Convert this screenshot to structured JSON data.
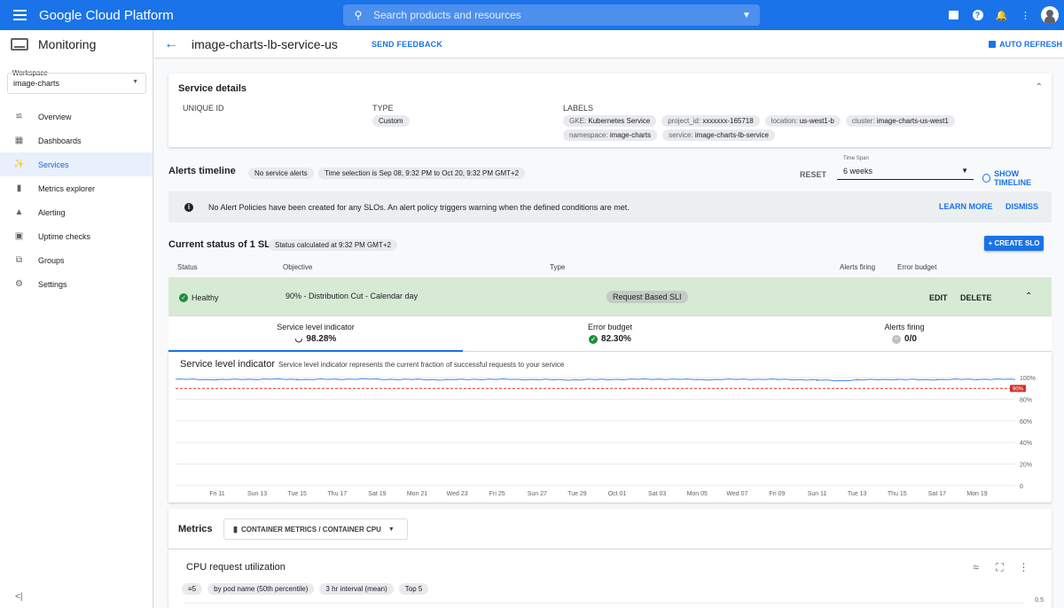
{
  "topbar": {
    "brand": "Google Cloud Platform",
    "search_placeholder": "Search products and resources",
    "icons": [
      "cloud-shell-icon",
      "help-icon",
      "notifications-icon",
      "more-vert-icon",
      "avatar"
    ]
  },
  "sidebar": {
    "title": "Monitoring",
    "workspace_label": "Workspace",
    "workspace_value": "image-charts",
    "items": [
      {
        "label": "Overview",
        "icon": "overview-icon",
        "active": false
      },
      {
        "label": "Dashboards",
        "icon": "dashboards-icon",
        "active": false
      },
      {
        "label": "Services",
        "icon": "services-icon",
        "active": true
      },
      {
        "label": "Metrics explorer",
        "icon": "metrics-explorer-icon",
        "active": false
      },
      {
        "label": "Alerting",
        "icon": "alerting-icon",
        "active": false
      },
      {
        "label": "Uptime checks",
        "icon": "uptime-checks-icon",
        "active": false
      },
      {
        "label": "Groups",
        "icon": "groups-icon",
        "active": false
      },
      {
        "label": "Settings",
        "icon": "settings-icon",
        "active": false
      }
    ]
  },
  "header": {
    "title": "image-charts-lb-service-us",
    "feedback": "SEND FEEDBACK",
    "auto_refresh": "AUTO REFRESH"
  },
  "service_details": {
    "title": "Service details",
    "unique_id_label": "UNIQUE ID",
    "type_label": "TYPE",
    "type_value": "Custom",
    "labels_label": "LABELS",
    "labels": [
      {
        "k": "GKE:",
        "v": "Kubernetes Service"
      },
      {
        "k": "project_id:",
        "v": "xxxxxxx-165718"
      },
      {
        "k": "location:",
        "v": "us-west1-b"
      },
      {
        "k": "cluster:",
        "v": "image-charts-us-west1"
      },
      {
        "k": "namespace:",
        "v": "image-charts"
      },
      {
        "k": "service:",
        "v": "image-charts-lb-service"
      }
    ]
  },
  "alerts_timeline": {
    "title": "Alerts timeline",
    "chip_no_alerts": "No service alerts",
    "chip_time": "Time selection is Sep 08, 9:32 PM to Oct 20, 9:32 PM GMT+2",
    "reset": "RESET",
    "time_span_label": "Time Span",
    "time_span_value": "6 weeks",
    "show_timeline": "SHOW TIMELINE"
  },
  "banner": {
    "text": "No Alert Policies have been created for any SLOs. An alert policy triggers warning when the defined conditions are met.",
    "learn_more": "LEARN MORE",
    "dismiss": "DISMISS"
  },
  "current_status": {
    "title": "Current status of 1 SLO",
    "chip": "Status calculated at 9:32 PM GMT+2",
    "create_button": "+ CREATE SLO",
    "columns": [
      "Status",
      "Objective",
      "Type",
      "Alerts firing",
      "Error budget"
    ],
    "row": {
      "status": "Healthy",
      "objective": "90% - Distribution Cut - Calendar day",
      "type": "Request Based SLI",
      "edit": "EDIT",
      "delete": "DELETE"
    },
    "tiles": [
      {
        "label": "Service level indicator",
        "value": "98.28%"
      },
      {
        "label": "Error budget",
        "value": "82.30%"
      },
      {
        "label": "Alerts firing",
        "value": "0/0"
      }
    ]
  },
  "sli_chart": {
    "title": "Service level indicator",
    "description": "Service level indicator represents the current fraction of successful requests to your service",
    "threshold_label": "90%"
  },
  "chart_data": {
    "type": "line",
    "x": [
      "Fri 11",
      "Sun 13",
      "Tue 15",
      "Thu 17",
      "Sat 19",
      "Mon 21",
      "Wed 23",
      "Fri 25",
      "Sun 27",
      "Tue 29",
      "Oct 01",
      "Sat 03",
      "Mon 05",
      "Wed 07",
      "Fri 09",
      "Sun 11",
      "Tue 13",
      "Thu 15",
      "Sat 17",
      "Mon 19"
    ],
    "ytick_labels": [
      "0",
      "20%",
      "40%",
      "60%",
      "80%",
      "100%"
    ],
    "yticks": [
      0,
      20,
      40,
      60,
      80,
      100
    ],
    "ylim": [
      0,
      100
    ],
    "threshold": 90,
    "series": [
      {
        "values": [
          98.4,
          98.1,
          98.5,
          98.2,
          98.6,
          98.3,
          98.0,
          98.4,
          98.2,
          97.9,
          98.3,
          98.5,
          98.1,
          98.4,
          98.2,
          97.2,
          98.3,
          98.0,
          98.4,
          98.3
        ]
      }
    ],
    "grid": true
  },
  "metrics": {
    "title": "Metrics",
    "select": "CONTAINER METRICS / CONTAINER CPU"
  },
  "cpu": {
    "title": "CPU request utilization",
    "chips": [
      "5",
      "by pod name (50th percentile)",
      "3 hr interval (mean)",
      "Top 5"
    ],
    "axis_top": "0.5"
  }
}
